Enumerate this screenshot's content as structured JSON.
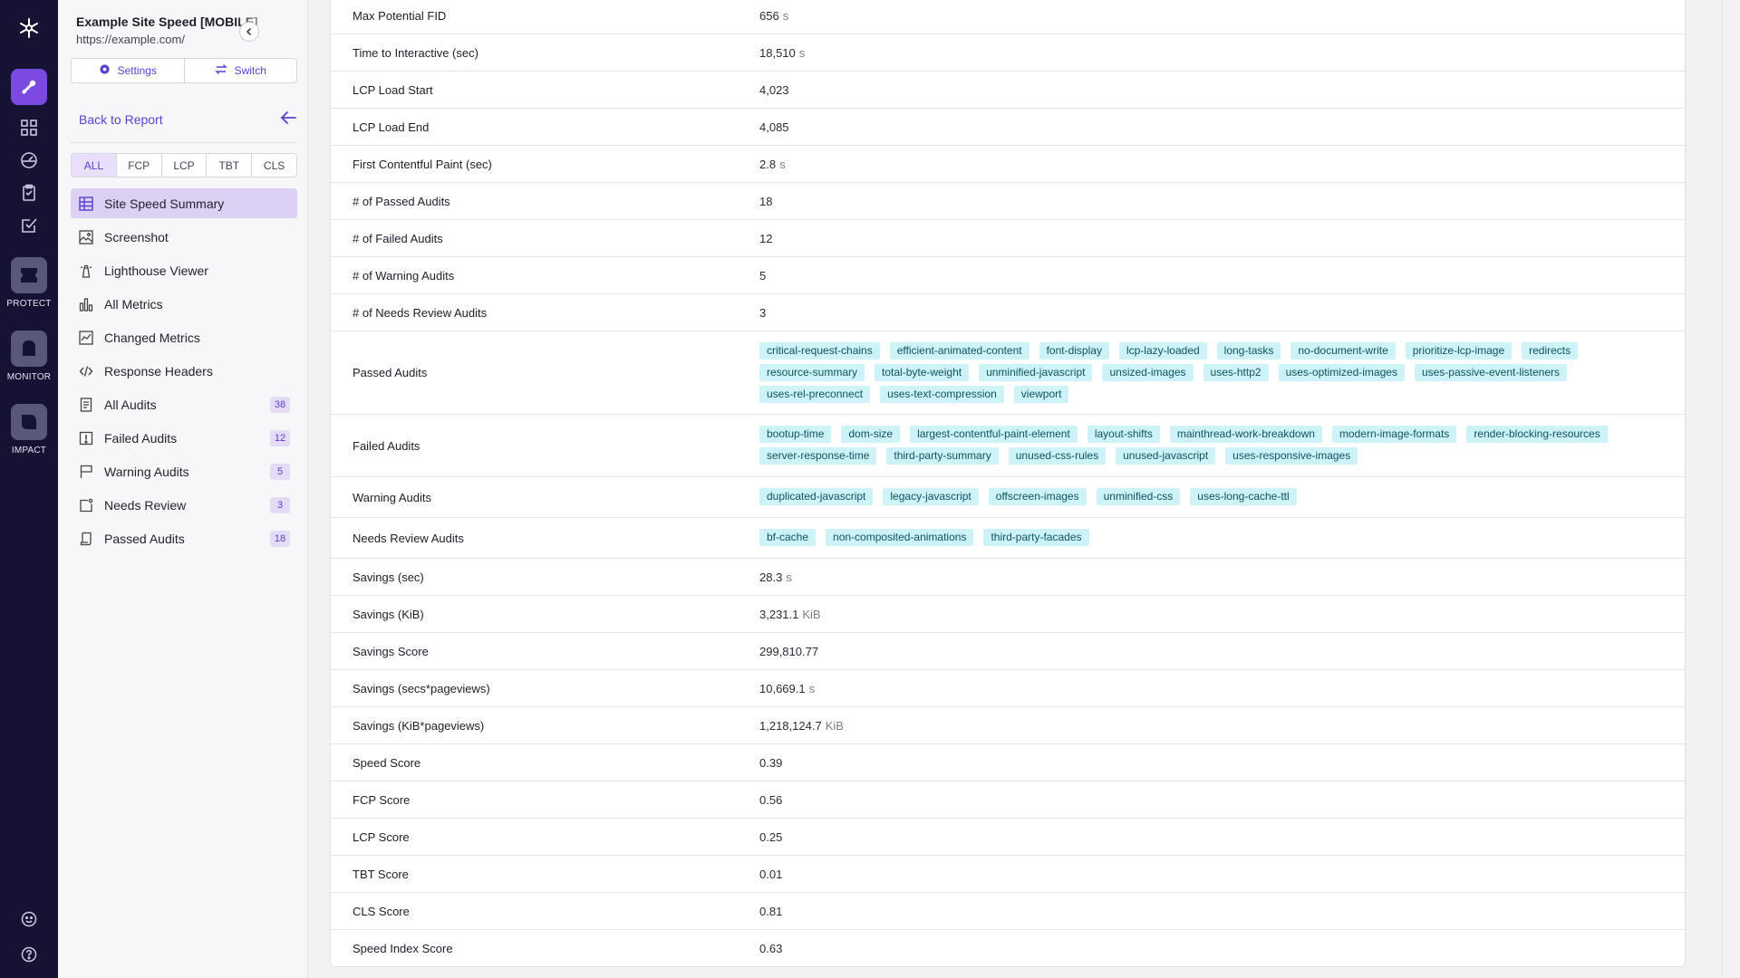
{
  "sidebar": {
    "title": "Example Site Speed [MOBILE]",
    "url": "https://example.com/",
    "settings_label": "Settings",
    "switch_label": "Switch",
    "back_label": "Back to Report",
    "filters": [
      "ALL",
      "FCP",
      "LCP",
      "TBT",
      "CLS"
    ],
    "nav": [
      {
        "label": "Site Speed Summary",
        "icon": "grid-icon",
        "badge": ""
      },
      {
        "label": "Screenshot",
        "icon": "image-icon",
        "badge": ""
      },
      {
        "label": "Lighthouse Viewer",
        "icon": "lighthouse-icon",
        "badge": ""
      },
      {
        "label": "All Metrics",
        "icon": "bar-chart-icon",
        "badge": ""
      },
      {
        "label": "Changed Metrics",
        "icon": "line-chart-icon",
        "badge": ""
      },
      {
        "label": "Response Headers",
        "icon": "code-icon",
        "badge": ""
      },
      {
        "label": "All Audits",
        "icon": "document-icon",
        "badge": "38"
      },
      {
        "label": "Failed Audits",
        "icon": "alert-icon",
        "badge": "12"
      },
      {
        "label": "Warning Audits",
        "icon": "flag-icon",
        "badge": "5"
      },
      {
        "label": "Needs Review",
        "icon": "review-icon",
        "badge": "3"
      },
      {
        "label": "Passed Audits",
        "icon": "passed-icon",
        "badge": "18"
      }
    ]
  },
  "rail": {
    "protect_label": "PROTECT",
    "monitor_label": "MONITOR",
    "impact_label": "IMPACT"
  },
  "metrics": [
    {
      "label": "Max Potential FID",
      "value": "656",
      "unit": "s"
    },
    {
      "label": "Time to Interactive (sec)",
      "value": "18,510",
      "unit": "s"
    },
    {
      "label": "LCP Load Start",
      "value": "4,023",
      "unit": ""
    },
    {
      "label": "LCP Load End",
      "value": "4,085",
      "unit": ""
    },
    {
      "label": "First Contentful Paint (sec)",
      "value": "2.8",
      "unit": "s"
    },
    {
      "label": "# of Passed Audits",
      "value": "18",
      "unit": ""
    },
    {
      "label": "# of Failed Audits",
      "value": "12",
      "unit": ""
    },
    {
      "label": "# of Warning Audits",
      "value": "5",
      "unit": ""
    },
    {
      "label": "# of Needs Review Audits",
      "value": "3",
      "unit": ""
    },
    {
      "label": "Passed Audits",
      "tags": [
        "critical-request-chains",
        "efficient-animated-content",
        "font-display",
        "lcp-lazy-loaded",
        "long-tasks",
        "no-document-write",
        "prioritize-lcp-image",
        "redirects",
        "resource-summary",
        "total-byte-weight",
        "unminified-javascript",
        "unsized-images",
        "uses-http2",
        "uses-optimized-images",
        "uses-passive-event-listeners",
        "uses-rel-preconnect",
        "uses-text-compression",
        "viewport"
      ]
    },
    {
      "label": "Failed Audits",
      "tags": [
        "bootup-time",
        "dom-size",
        "largest-contentful-paint-element",
        "layout-shifts",
        "mainthread-work-breakdown",
        "modern-image-formats",
        "render-blocking-resources",
        "server-response-time",
        "third-party-summary",
        "unused-css-rules",
        "unused-javascript",
        "uses-responsive-images"
      ]
    },
    {
      "label": "Warning Audits",
      "tags": [
        "duplicated-javascript",
        "legacy-javascript",
        "offscreen-images",
        "unminified-css",
        "uses-long-cache-ttl"
      ]
    },
    {
      "label": "Needs Review Audits",
      "tags": [
        "bf-cache",
        "non-composited-animations",
        "third-party-facades"
      ]
    },
    {
      "label": "Savings (sec)",
      "value": "28.3",
      "unit": "s"
    },
    {
      "label": "Savings (KiB)",
      "value": "3,231.1",
      "unit": "KiB"
    },
    {
      "label": "Savings Score",
      "value": "299,810.77",
      "unit": ""
    },
    {
      "label": "Savings (secs*pageviews)",
      "value": "10,669.1",
      "unit": "s"
    },
    {
      "label": "Savings (KiB*pageviews)",
      "value": "1,218,124.7",
      "unit": "KiB"
    },
    {
      "label": "Speed Score",
      "value": "0.39",
      "unit": ""
    },
    {
      "label": "FCP Score",
      "value": "0.56",
      "unit": ""
    },
    {
      "label": "LCP Score",
      "value": "0.25",
      "unit": ""
    },
    {
      "label": "TBT Score",
      "value": "0.01",
      "unit": ""
    },
    {
      "label": "CLS Score",
      "value": "0.81",
      "unit": ""
    },
    {
      "label": "Speed Index Score",
      "value": "0.63",
      "unit": ""
    }
  ],
  "colors": {
    "accent": "#5b3fd0",
    "rail_bg": "#161234",
    "active_app": "#7a4ae0",
    "tag_bg": "#cdf3f8",
    "tag_text": "#0e5360"
  }
}
